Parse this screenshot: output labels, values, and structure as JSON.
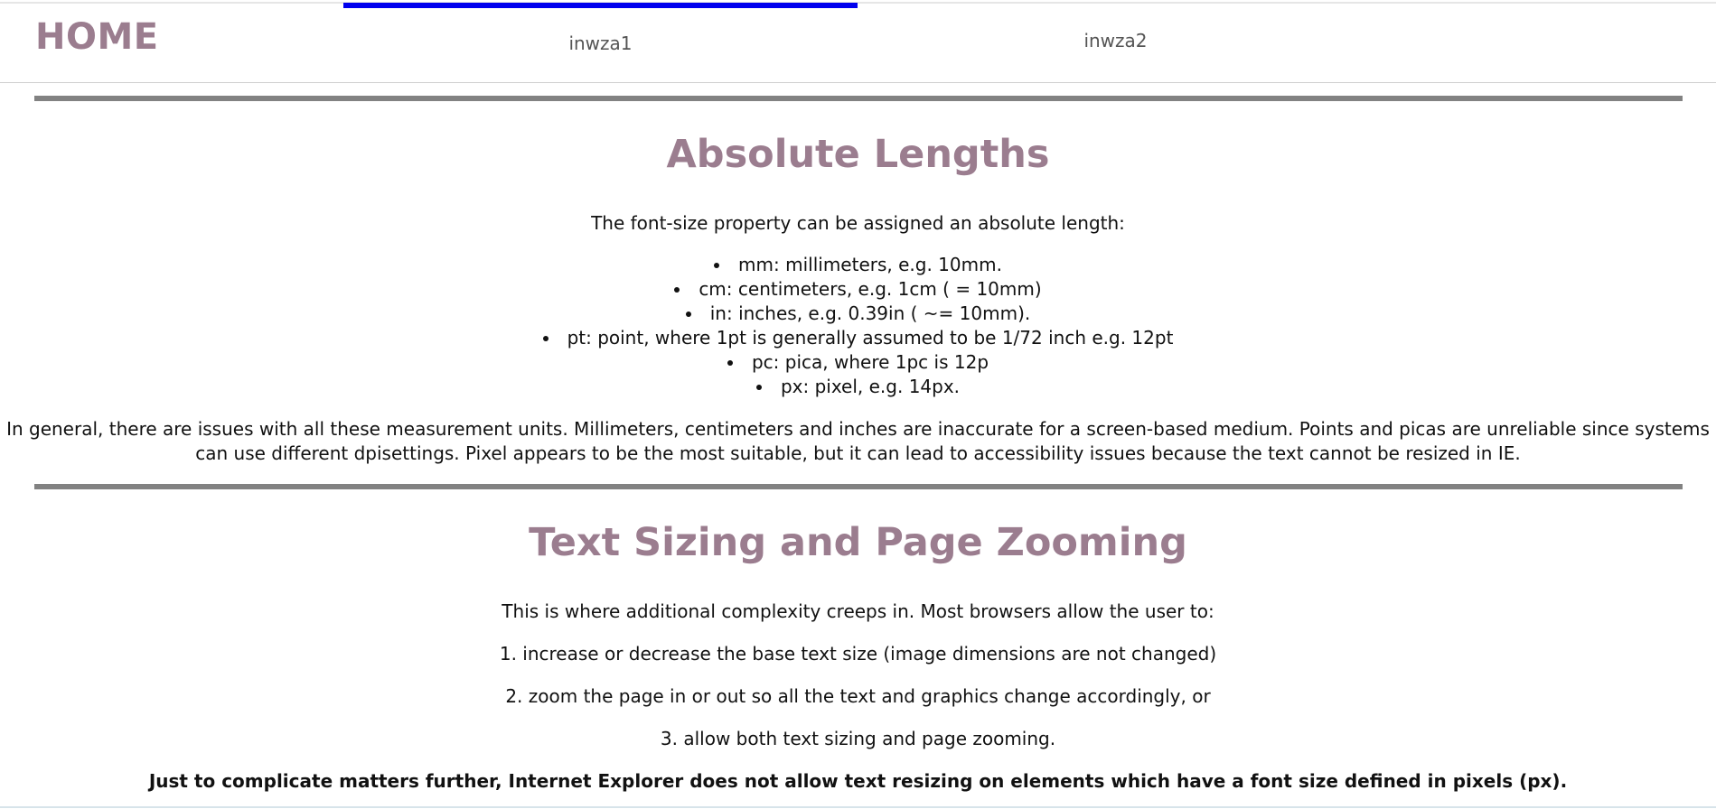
{
  "nav": {
    "home": "HOME",
    "tabs": [
      {
        "label": "inwza1",
        "active": true
      },
      {
        "label": "inwza2",
        "active": false
      }
    ]
  },
  "sections": [
    {
      "title": "Absolute Lengths",
      "intro": "The font-size property can be assigned an absolute length:",
      "items": [
        "mm: millimeters, e.g. 10mm.",
        "cm: centimeters, e.g. 1cm ( = 10mm)",
        "in: inches, e.g. 0.39in ( ~= 10mm).",
        "pt: point, where 1pt is generally assumed to be 1/72 inch e.g. 12pt",
        "pc: pica, where 1pc is 12p",
        "px: pixel, e.g. 14px."
      ],
      "paragraph": "In general, there are issues with all these measurement units. Millimeters, centimeters and inches are inaccurate for a screen-based medium. Points and picas are unreliable since systems can use different dpisettings. Pixel appears to be the most suitable, but it can lead to accessibility issues because the text cannot be resized in IE."
    },
    {
      "title": "Text Sizing and Page Zooming",
      "intro": "This is where additional complexity creeps in. Most browsers allow the user to:",
      "steps": [
        "1. increase or decrease the base text size (image dimensions are not changed)",
        "2. zoom the page in or out so all the text and graphics change accordingly, or",
        "3. allow both text sizing and page zooming."
      ],
      "note": "Just to complicate matters further, Internet Explorer does not allow text resizing on elements which have a font size defined in pixels (px)."
    }
  ],
  "colors": {
    "heading": "#9b7d8f",
    "active_tab_bar": "#0000ee",
    "rule": "#828282"
  }
}
